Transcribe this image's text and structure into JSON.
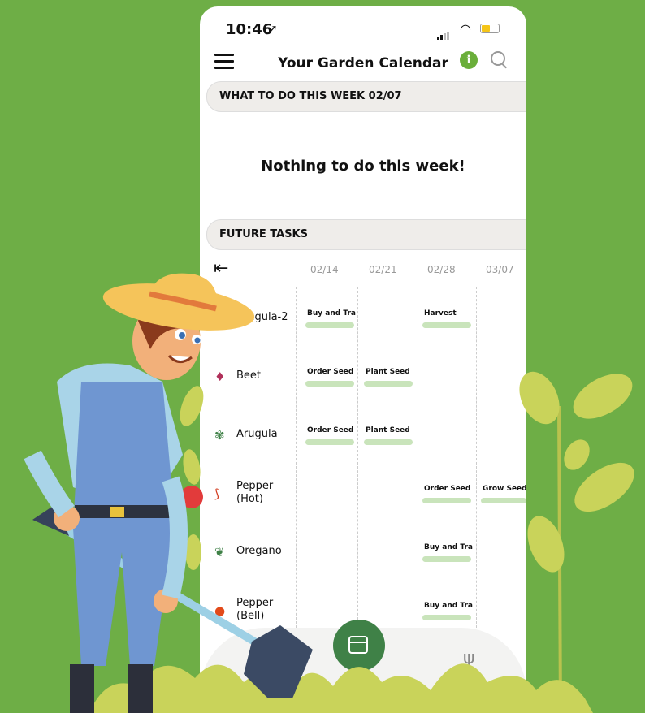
{
  "status": {
    "time": "10:46",
    "location_icon": "location-arrow-icon",
    "signal_icon": "signal-icon",
    "wifi_icon": "wifi-icon",
    "battery_icon": "battery-icon"
  },
  "header": {
    "title": "Your Garden Calendar",
    "menu_icon": "hamburger-menu-icon",
    "info_icon": "info-icon",
    "info_label": "i",
    "search_icon": "search-icon"
  },
  "this_week": {
    "title": "WHAT TO DO THIS WEEK 02/07",
    "empty_message": "Nothing to do this week!"
  },
  "future": {
    "title": "FUTURE TASKS",
    "back_icon": "collapse-left-icon",
    "dates": [
      "02/14",
      "02/21",
      "02/28",
      "03/07"
    ],
    "plants": [
      {
        "name": "Arugula-2",
        "icon": "arugula-icon",
        "tasks": [
          "Buy and Tran...",
          "",
          "Harvest",
          ""
        ]
      },
      {
        "name": "Beet",
        "icon": "beet-icon",
        "tasks": [
          "Order Seed",
          "Plant Seed",
          "",
          ""
        ]
      },
      {
        "name": "Arugula",
        "icon": "arugula-icon",
        "tasks": [
          "Order Seed",
          "Plant Seed",
          "",
          ""
        ]
      },
      {
        "name": "Pepper (Hot)",
        "icon": "hot-pepper-icon",
        "tasks": [
          "",
          "",
          "Order Seed",
          "Grow Seedlin"
        ]
      },
      {
        "name": "Oregano",
        "icon": "oregano-icon",
        "tasks": [
          "",
          "",
          "Buy and Tran...",
          ""
        ]
      },
      {
        "name": "Pepper (Bell)",
        "icon": "bell-pepper-icon",
        "tasks": [
          "",
          "",
          "Buy and Tran...",
          ""
        ]
      }
    ]
  },
  "nav": {
    "calendar_icon": "calendar-icon",
    "recipes_icon": "fork-knife-icon"
  },
  "colors": {
    "background": "#6eae46",
    "accent": "#3f8147",
    "bar": "#c9e4bb",
    "info": "#6aae3a"
  }
}
